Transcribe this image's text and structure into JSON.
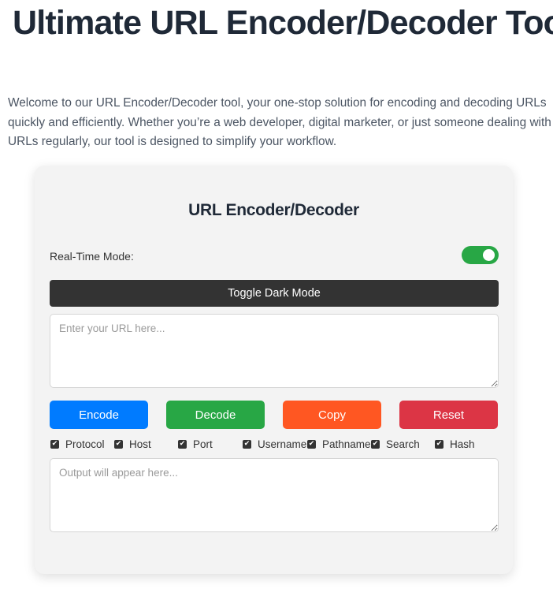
{
  "page": {
    "title": "Ultimate URL Encoder/Decoder Tool",
    "intro": "Welcome to our URL Encoder/Decoder tool, your one-stop solution for encoding and decoding URLs quickly and efficiently. Whether you’re a web developer, digital marketer, or just someone dealing with URLs regularly, our tool is designed to simplify your workflow."
  },
  "tool": {
    "title": "URL Encoder/Decoder",
    "realtime_label": "Real-Time Mode:",
    "realtime_enabled": true,
    "dark_mode_button": "Toggle Dark Mode",
    "input": {
      "value": "",
      "placeholder": "Enter your URL here..."
    },
    "output": {
      "value": "",
      "placeholder": "Output will appear here..."
    },
    "buttons": {
      "encode": "Encode",
      "decode": "Decode",
      "copy": "Copy",
      "reset": "Reset"
    },
    "components": [
      {
        "label": "Protocol",
        "checked": true
      },
      {
        "label": "Host",
        "checked": true
      },
      {
        "label": "Port",
        "checked": true
      },
      {
        "label": "Username",
        "checked": true
      },
      {
        "label": "Pathname",
        "checked": true
      },
      {
        "label": "Search",
        "checked": true
      },
      {
        "label": "Hash",
        "checked": true
      }
    ],
    "checkmark_icon": "✔"
  },
  "colors": {
    "encode": "#007bff",
    "decode": "#28a745",
    "copy": "#ff5722",
    "reset": "#dc3545",
    "toggle_on": "#28a745",
    "dark_button": "#333333",
    "card_bg": "#f3f3f3"
  }
}
